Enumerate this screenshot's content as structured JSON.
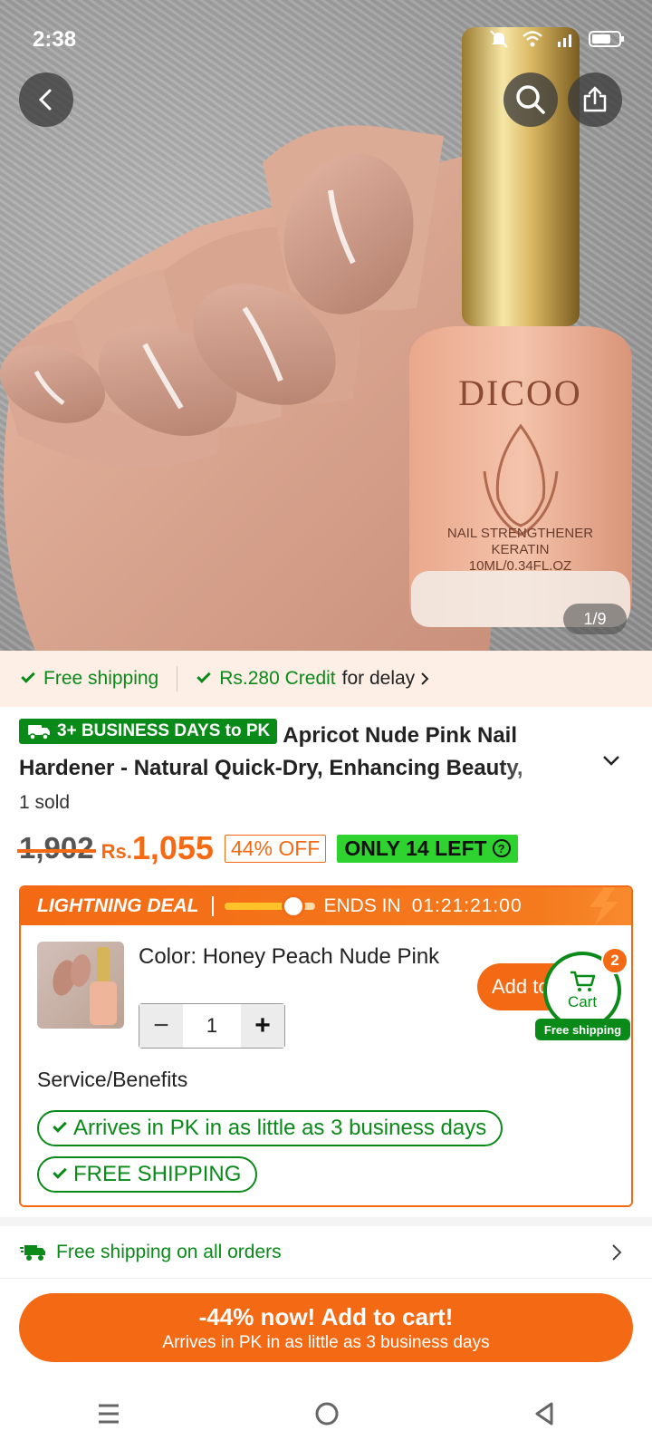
{
  "status_bar": {
    "time": "2:38"
  },
  "hero": {
    "brand": "DICOO",
    "bottle_line1": "NAIL STRENGTHENER",
    "bottle_line2": "KERATIN",
    "bottle_line3": "10ML/0.34FL.OZ",
    "image_counter": "1/9"
  },
  "benefits_strip": {
    "free_shipping": "Free shipping",
    "credit": "Rs.280 Credit",
    "credit_suffix": "for delay"
  },
  "product": {
    "delivery_badge": "3+ BUSINESS DAYS to PK",
    "title": "Apricot Nude Pink Nail Hardener - Natural Quick-Dry, Enhancing Beauty,",
    "sold": "1 sold",
    "old_price": "1,902",
    "currency": "Rs.",
    "price": "1,055",
    "discount": "44% OFF",
    "stock": "ONLY 14 LEFT",
    "help_glyph": "?"
  },
  "deal": {
    "title": "LIGHTNING DEAL",
    "progress_fraction": 0.76,
    "ends_label": "ENDS IN",
    "timer": "01:21:21:00",
    "color_label": "Color: Honey Peach Nude Pink",
    "quantity": "1",
    "add_label": "Add to",
    "services_title": "Service/Benefits",
    "service_1": "Arrives in PK in as little as 3 business days",
    "service_2": "FREE SHIPPING"
  },
  "cart_float": {
    "label": "Cart",
    "count": "2",
    "free_label": "Free shipping"
  },
  "shipping_row": {
    "text": "Free shipping on all orders"
  },
  "cta": {
    "main": "-44% now! Add to cart!",
    "sub": "Arrives in PK in as little as 3 business days"
  },
  "colors": {
    "accent": "#f46a14",
    "green": "#0a8a18",
    "stock_green": "#2fd32f"
  }
}
